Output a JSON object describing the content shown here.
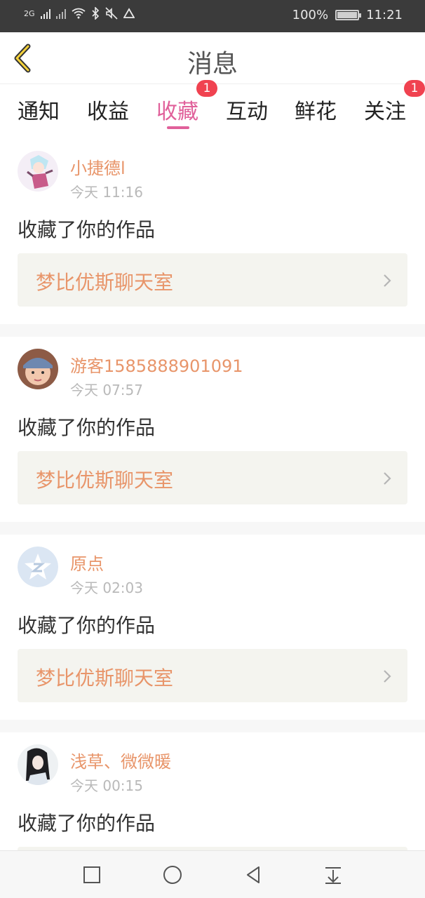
{
  "status_bar": {
    "network": "2G",
    "battery": "100%",
    "time": "11:21"
  },
  "header": {
    "title": "消息",
    "back_icon": "chevron-left-icon"
  },
  "tabs": [
    {
      "label": "通知"
    },
    {
      "label": "收益"
    },
    {
      "label": "收藏",
      "active": true,
      "badge": "1"
    },
    {
      "label": "互动"
    },
    {
      "label": "鲜花"
    },
    {
      "label": "关注",
      "badge": "1"
    }
  ],
  "colors": {
    "accent": "#e0609a",
    "name": "#e8956a",
    "badge": "#f04250"
  },
  "items": [
    {
      "name": "小捷德l",
      "time": "今天 11:16",
      "action": "收藏了你的作品",
      "work": "梦比优斯聊天室"
    },
    {
      "name": "游客1585888901091",
      "time": "今天 07:57",
      "action": "收藏了你的作品",
      "work": "梦比优斯聊天室"
    },
    {
      "name": "原点",
      "time": "今天 02:03",
      "action": "收藏了你的作品",
      "work": "梦比优斯聊天室"
    },
    {
      "name": "浅草、微微暖",
      "time": "今天 00:15",
      "action": "收藏了你的作品",
      "work": ""
    }
  ],
  "nav": [
    "square-icon",
    "circle-icon",
    "back-triangle-icon",
    "notification-pulldown-icon"
  ]
}
